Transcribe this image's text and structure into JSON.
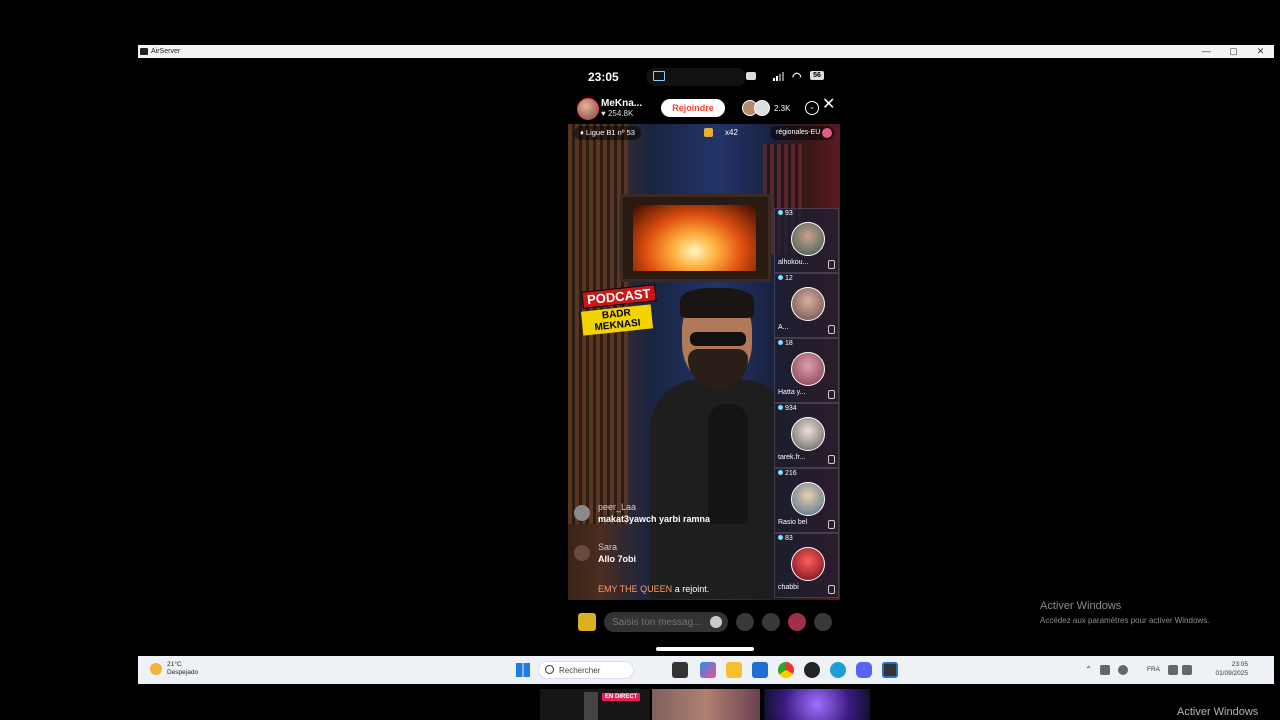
{
  "window": {
    "title": "AirServer",
    "controls": [
      "—",
      "▢",
      "✕"
    ]
  },
  "phone_status": {
    "time": "23:05",
    "battery": "56"
  },
  "live": {
    "host_name": "MeKna...",
    "host_likes": "254.8K",
    "join_label": "Rejoindre",
    "viewer_count": "2.3K",
    "close_glyph": "✕",
    "league": "Ligue B1 nº 53",
    "gift_count": "x42",
    "region": "régionales-EU",
    "overlay_title": "PODCAST",
    "overlay_subtitle": "BADR MEKNASI"
  },
  "guests": [
    {
      "score": "93",
      "name": "alhokou..."
    },
    {
      "score": "12",
      "name": "A..."
    },
    {
      "score": "18",
      "name": "Hatta y..."
    },
    {
      "score": "934",
      "name": "tarek.fr..."
    },
    {
      "score": "216",
      "name": "Rasio bel"
    },
    {
      "score": "83",
      "name": "chabbi"
    }
  ],
  "chat": [
    {
      "user": "peer_Laa",
      "text": "makat3yawch yarbi ramna"
    },
    {
      "user": "Sara",
      "text": "Allo 7obi"
    }
  ],
  "join_note": {
    "user": "EMY THE QUEEN",
    "text": "a rejoint."
  },
  "input": {
    "placeholder": "Saisis ton messag..."
  },
  "activate_windows": {
    "title": "Activer Windows",
    "subtitle": "Accédez aux paramètres pour activer Windows.",
    "watermark": "Activer Windows"
  },
  "taskbar": {
    "temperature": "21°C",
    "weather": "Despejado",
    "search_label": "Rechercher",
    "language": "FRA",
    "time": "23:05",
    "date": "01/09/2025"
  },
  "thumbnails": {
    "live_badge": "EN DIRECT"
  },
  "colors": {
    "join_text": "#ff3a2a",
    "live_badge": "#e0245a",
    "taskbar_bg": "#eef1f6"
  }
}
